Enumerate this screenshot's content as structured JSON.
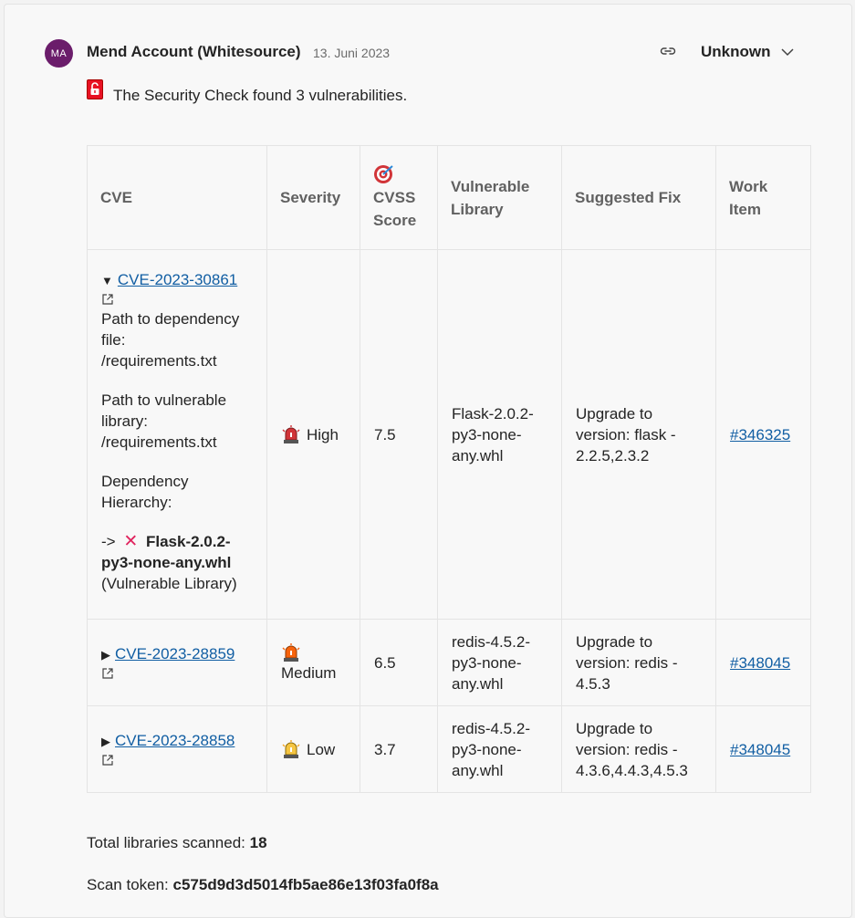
{
  "header": {
    "avatar_initials": "MA",
    "author": "Mend Account (Whitesource)",
    "date": "13. Juni 2023",
    "status": "Unknown"
  },
  "summary": "The Security Check found 3 vulnerabilities.",
  "table": {
    "headers": {
      "cve": "CVE",
      "severity": "Severity",
      "cvss": "CVSS Score",
      "library": "Vulnerable Library",
      "fix": "Suggested Fix",
      "work_item": "Work Item"
    },
    "rows": [
      {
        "expanded": true,
        "cve": "CVE-2023-30861",
        "path_dep_label": "Path to dependency file:",
        "path_dep_value": "/requirements.txt",
        "path_vuln_label": "Path to vulnerable library:",
        "path_vuln_value": "/requirements.txt",
        "hierarchy_label": "Dependency Hierarchy:",
        "hierarchy_prefix": "->",
        "hierarchy_lib": "Flask-2.0.2-py3-none-any.whl",
        "hierarchy_suffix": "(Vulnerable Library)",
        "severity": "High",
        "cvss": "7.5",
        "library": "Flask-2.0.2-py3-none-any.whl",
        "fix": "Upgrade to version: flask - 2.2.5,2.3.2",
        "work_item": "#346325"
      },
      {
        "expanded": false,
        "cve": "CVE-2023-28859",
        "severity": "Medium",
        "cvss": "6.5",
        "library": "redis-4.5.2-py3-none-any.whl",
        "fix": "Upgrade to version: redis - 4.5.3",
        "work_item": "#348045"
      },
      {
        "expanded": false,
        "cve": "CVE-2023-28858",
        "severity": "Low",
        "cvss": "3.7",
        "library": "redis-4.5.2-py3-none-any.whl",
        "fix": "Upgrade to version: redis - 4.3.6,4.4.3,4.5.3",
        "work_item": "#348045"
      }
    ]
  },
  "footer": {
    "libs_label": "Total libraries scanned:",
    "libs_value": "18",
    "token_label": "Scan token:",
    "token_value": "c575d9d3d5014fb5ae86e13f03fa0f8a"
  },
  "colors": {
    "avatar": "#6b1d6b",
    "link": "#115ea3",
    "severity_high": "#d13438",
    "severity_medium": "#f7630c",
    "severity_low": "#f5a623"
  },
  "icons": [
    "link-icon",
    "chevron-down-icon",
    "unlocked-lock-icon",
    "target-icon",
    "external-link-icon",
    "siren-icon",
    "cross-mark-icon",
    "triangle-down-icon",
    "triangle-right-icon"
  ]
}
